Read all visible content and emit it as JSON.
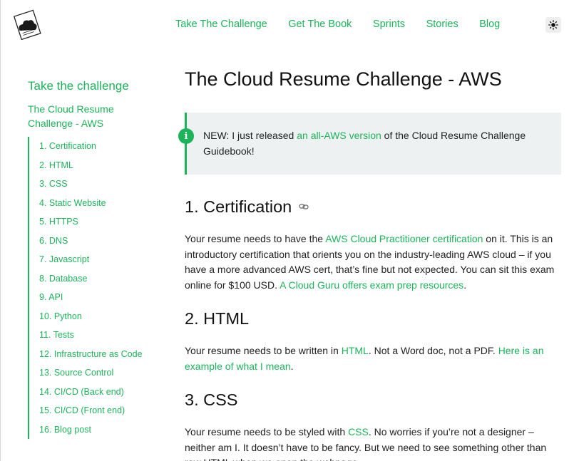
{
  "header": {
    "nav": [
      "Take The Challenge",
      "Get The Book",
      "Sprints",
      "Stories",
      "Blog"
    ],
    "theme_toggle_icon": "sun-icon"
  },
  "sidebar": {
    "title": "Take the challenge",
    "subtitle": "The Cloud Resume Challenge - AWS",
    "items": [
      "1. Certification",
      "2. HTML",
      "3. CSS",
      "4. Static Website",
      "5. HTTPS",
      "6. DNS",
      "7. Javascript",
      "8. Database",
      "9. API",
      "10. Python",
      "11. Tests",
      "12. Infrastructure as Code",
      "13. Source Control",
      "14. CI/CD (Back end)",
      "15. CI/CD (Front end)",
      "16. Blog post"
    ]
  },
  "main": {
    "title": "The Cloud Resume Challenge - AWS",
    "callout": {
      "icon": "info-icon",
      "pre": "NEW: I just released ",
      "link": "an all-AWS version",
      "post": " of the Cloud Resume Challenge Guidebook!"
    },
    "sections": {
      "certification": {
        "heading": "1. Certification",
        "t1": "Your resume needs to have the ",
        "l1": "AWS Cloud Practitioner certification",
        "t2": " on it. This is an introductory certification that orients you on the industry-leading AWS cloud – if you have a more advanced AWS cert, that’s fine but not expected. You can sit this exam online for $100 USD. ",
        "l2": "A Cloud Guru offers exam prep resources",
        "t3": "."
      },
      "html": {
        "heading": "2. HTML",
        "t1": "Your resume needs to be written in ",
        "l1": "HTML",
        "t2": ". Not a Word doc, not a PDF. ",
        "l2": "Here is an example of what I mean",
        "t3": "."
      },
      "css": {
        "heading": "3. CSS",
        "t1": "Your resume needs to be styled with ",
        "l1": "CSS",
        "t2": ". No worries if you’re not a designer – neither am I. It doesn’t have to be fancy. But we need to see something other than raw HTML when we open the webpage."
      }
    }
  },
  "colors": {
    "accent": "#1cb35a",
    "callout_bg": "#eef1f2",
    "text": "#222222"
  }
}
